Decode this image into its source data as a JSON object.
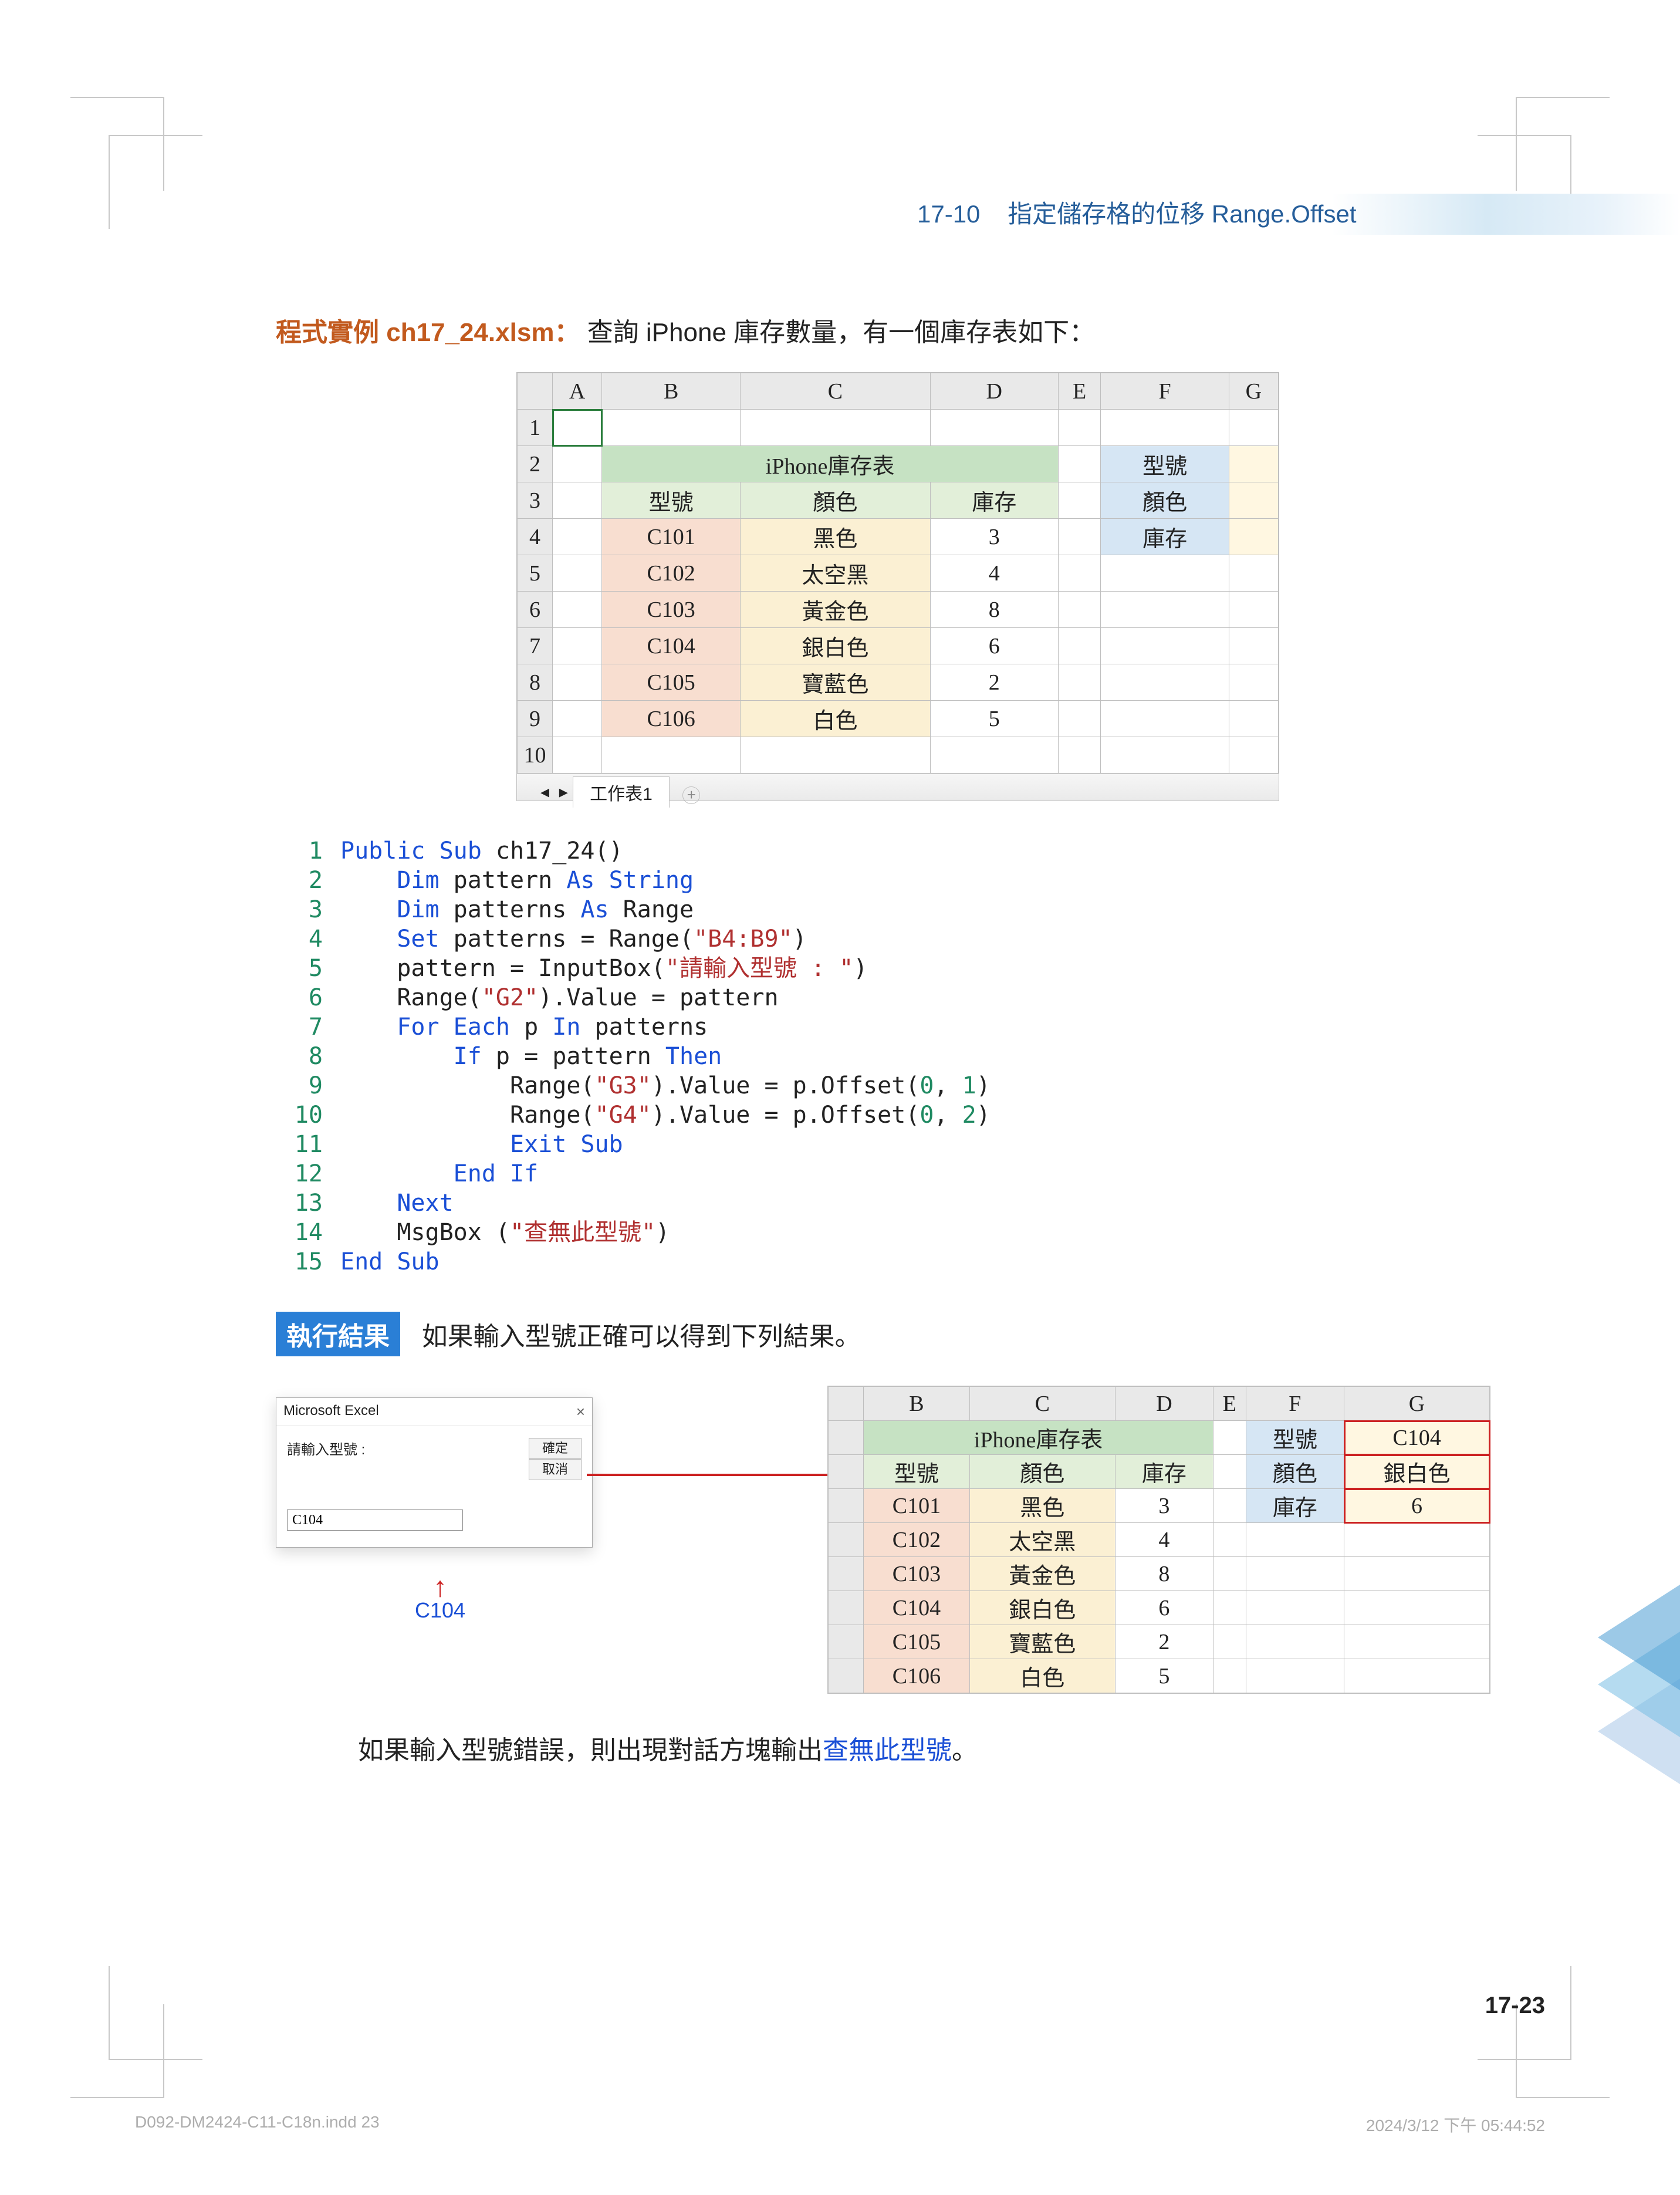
{
  "header": {
    "section": "17-10",
    "title": "指定儲存格的位移 Range.Offset"
  },
  "intro": {
    "prefix": "程式實例 ch17_24.xlsm：",
    "text": "查詢 iPhone 庫存數量，有一個庫存表如下："
  },
  "table1": {
    "cols": [
      "A",
      "B",
      "C",
      "D",
      "E",
      "F",
      "G"
    ],
    "title": "iPhone庫存表",
    "subhdr": [
      "型號",
      "顏色",
      "庫存"
    ],
    "lookup_labels": [
      "型號",
      "顏色",
      "庫存"
    ],
    "rows": [
      {
        "model": "C101",
        "color": "黑色",
        "stock": "3"
      },
      {
        "model": "C102",
        "color": "太空黑",
        "stock": "4"
      },
      {
        "model": "C103",
        "color": "黃金色",
        "stock": "8"
      },
      {
        "model": "C104",
        "color": "銀白色",
        "stock": "6"
      },
      {
        "model": "C105",
        "color": "寶藍色",
        "stock": "2"
      },
      {
        "model": "C106",
        "color": "白色",
        "stock": "5"
      }
    ],
    "sheet_tab": "工作表1"
  },
  "code": {
    "lines": [
      [
        {
          "t": "Public Sub",
          "c": "kw"
        },
        {
          "t": " ch17_24()"
        }
      ],
      [
        {
          "t": "    Dim",
          "c": "kw"
        },
        {
          "t": " pattern "
        },
        {
          "t": "As String",
          "c": "ty"
        }
      ],
      [
        {
          "t": "    Dim",
          "c": "kw"
        },
        {
          "t": " patterns "
        },
        {
          "t": "As",
          "c": "ty"
        },
        {
          "t": " Range"
        }
      ],
      [
        {
          "t": "    Set",
          "c": "kw"
        },
        {
          "t": " patterns = Range("
        },
        {
          "t": "\"B4:B9\"",
          "c": "str"
        },
        {
          "t": ")"
        }
      ],
      [
        {
          "t": "    pattern = InputBox("
        },
        {
          "t": "\"請輸入型號 : \"",
          "c": "str"
        },
        {
          "t": ")"
        }
      ],
      [
        {
          "t": "    Range("
        },
        {
          "t": "\"G2\"",
          "c": "str"
        },
        {
          "t": ").Value = pattern"
        }
      ],
      [
        {
          "t": "    For Each",
          "c": "kw"
        },
        {
          "t": " p "
        },
        {
          "t": "In",
          "c": "kw"
        },
        {
          "t": " patterns"
        }
      ],
      [
        {
          "t": "        If",
          "c": "kw"
        },
        {
          "t": " p = pattern "
        },
        {
          "t": "Then",
          "c": "kw"
        }
      ],
      [
        {
          "t": "            Range("
        },
        {
          "t": "\"G3\"",
          "c": "str"
        },
        {
          "t": ").Value = p.Offset("
        },
        {
          "t": "0",
          "c": "num"
        },
        {
          "t": ", "
        },
        {
          "t": "1",
          "c": "num"
        },
        {
          "t": ")"
        }
      ],
      [
        {
          "t": "            Range("
        },
        {
          "t": "\"G4\"",
          "c": "str"
        },
        {
          "t": ").Value = p.Offset("
        },
        {
          "t": "0",
          "c": "num"
        },
        {
          "t": ", "
        },
        {
          "t": "2",
          "c": "num"
        },
        {
          "t": ")"
        }
      ],
      [
        {
          "t": "            Exit Sub",
          "c": "kw"
        }
      ],
      [
        {
          "t": "        End If",
          "c": "kw"
        }
      ],
      [
        {
          "t": "    Next",
          "c": "kw"
        }
      ],
      [
        {
          "t": "    MsgBox ("
        },
        {
          "t": "\"查無此型號\"",
          "c": "str"
        },
        {
          "t": ")"
        }
      ],
      [
        {
          "t": "End Sub",
          "c": "kw"
        }
      ]
    ]
  },
  "result": {
    "badge": "執行結果",
    "desc": "如果輸入型號正確可以得到下列結果。",
    "dialog": {
      "app": "Microsoft Excel",
      "label": "請輸入型號 :",
      "ok": "確定",
      "cancel": "取消",
      "value": "C104",
      "caption": "C104"
    },
    "table2": {
      "cols": [
        "B",
        "C",
        "D",
        "E",
        "F",
        "G"
      ],
      "title": "iPhone庫存表",
      "subhdr": [
        "型號",
        "顏色",
        "庫存"
      ],
      "lookup_labels": [
        "型號",
        "顏色",
        "庫存"
      ],
      "lookup_values": [
        "C104",
        "銀白色",
        "6"
      ],
      "rows": [
        {
          "model": "C101",
          "color": "黑色",
          "stock": "3"
        },
        {
          "model": "C102",
          "color": "太空黑",
          "stock": "4"
        },
        {
          "model": "C103",
          "color": "黃金色",
          "stock": "8"
        },
        {
          "model": "C104",
          "color": "銀白色",
          "stock": "6"
        },
        {
          "model": "C105",
          "color": "寶藍色",
          "stock": "2"
        },
        {
          "model": "C106",
          "color": "白色",
          "stock": "5"
        }
      ]
    }
  },
  "error_line": {
    "pre": "如果輸入型號錯誤，則出現對話方塊輸出",
    "link": "查無此型號",
    "post": "。"
  },
  "page_number": "17-23",
  "footer": {
    "left": "D092-DM2424-C11-C18n.indd   23",
    "right": "2024/3/12   下午 05:44:52"
  }
}
